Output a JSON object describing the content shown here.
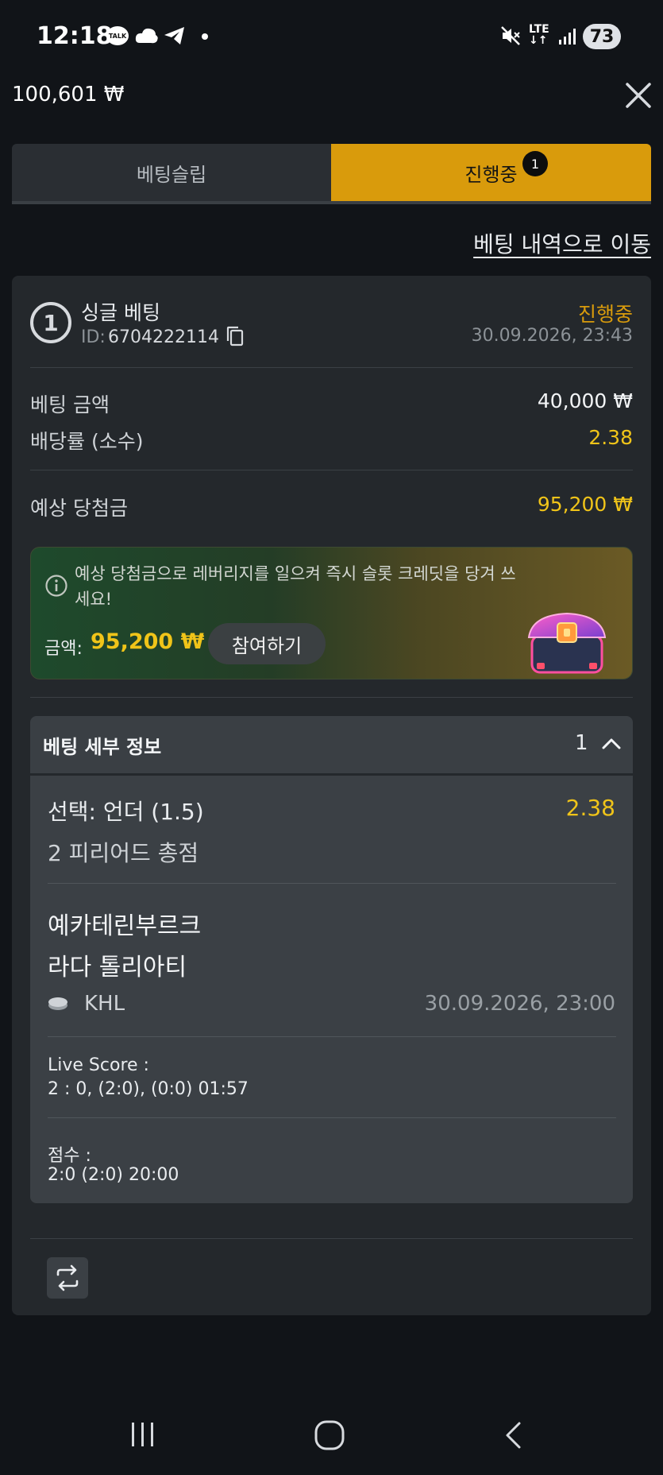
{
  "status_bar": {
    "time": "12:18",
    "talk_label": "TALK",
    "network": "LTE",
    "battery": "73"
  },
  "header": {
    "balance": "100,601 ₩"
  },
  "tabs": [
    {
      "label": "베팅슬립",
      "active": false
    },
    {
      "label": "진행중",
      "active": true,
      "badge": "1"
    }
  ],
  "history_link": "베팅 내역으로 이동",
  "bet": {
    "number": "1",
    "type": "싱글 베팅",
    "id_label": "ID:",
    "id": "6704222114",
    "status": "진행중",
    "date": "30.09.2026, 23:43",
    "amount_label": "베팅 금액",
    "amount": "40,000 ₩",
    "odds_label": "배당률 (소수)",
    "odds": "2.38",
    "potential_label": "예상 당첨금",
    "potential": "95,200 ₩"
  },
  "promo": {
    "text": "예상 당첨금으로 레버리지를 일으켜 즉시 슬롯 크레딧을 당겨 쓰세요!",
    "amount_label": "금액:",
    "amount": "95,200 ₩",
    "join_label": "참여하기"
  },
  "details": {
    "title": "베팅 세부 정보",
    "count": "1",
    "pick": "선택: 언더 (1.5)",
    "pick_odds": "2.38",
    "market": "2 피리어드 총점",
    "team_home": "예카테린부르크",
    "team_away": "라다 톨리아티",
    "league": "KHL",
    "match_date": "30.09.2026, 23:00",
    "live_score_label": "Live Score :",
    "live_score": "2 : 0, (2:0), (0:0) 01:57",
    "score_label": "점수 :",
    "score": "2:0 (2:0) 20:00"
  },
  "colors": {
    "accent": "#d99b0c",
    "highlight": "#f0c419",
    "background": "#111418",
    "card": "#24282c"
  }
}
